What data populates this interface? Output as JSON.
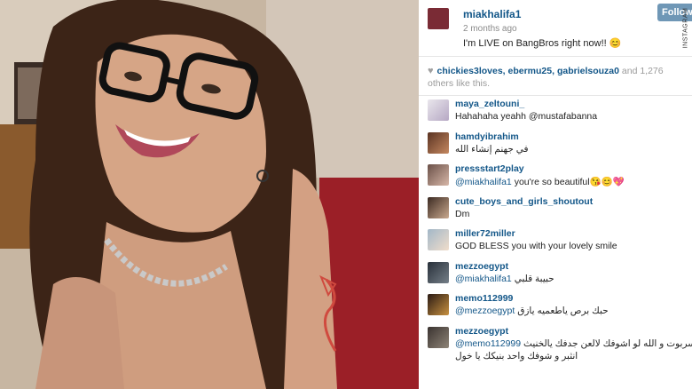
{
  "post": {
    "username": "miakhalifa1",
    "time_ago": "2 months ago",
    "caption": "I'm LIVE on BangBros right now!! 😊",
    "follow_label": "Follow",
    "brand": "INSTAGRAM"
  },
  "likes": {
    "line1_users": "chickies3loves, ebermu25, gabrielsouza0",
    "line1_suffix": " and 1,276",
    "line2": "others like this."
  },
  "comments": [
    {
      "user": "maya_zeltouni_",
      "mention": "",
      "text": "Hahahaha yeahh @mustafabanna"
    },
    {
      "user": "hamdyibrahim",
      "mention": "",
      "text": "في جهنم إنشاء الله"
    },
    {
      "user": "pressstart2play",
      "mention": "@miakhalifa1",
      "text": " you're so beautiful😘😊💖"
    },
    {
      "user": "cute_boys_and_girls_shoutout",
      "mention": "",
      "text": "Dm"
    },
    {
      "user": "miller72miller",
      "mention": "",
      "text": "GOD BLESS you with your lovely smile"
    },
    {
      "user": "mezzoegypt",
      "mention": "@miakhalifa1",
      "text": " حبيبة قلبي"
    },
    {
      "user": "memo112999",
      "mention": "@mezzoegypt",
      "text": " حبك برص ياطعميه يازق"
    },
    {
      "user": "mezzoegypt",
      "mention": "@memo112999",
      "text": " كل زق يا السربوت و الله لو اشوفك لالعن جدفك يالخنيث",
      "text2": "انثبر و شوفك واحد بنيكك يا خول"
    }
  ]
}
